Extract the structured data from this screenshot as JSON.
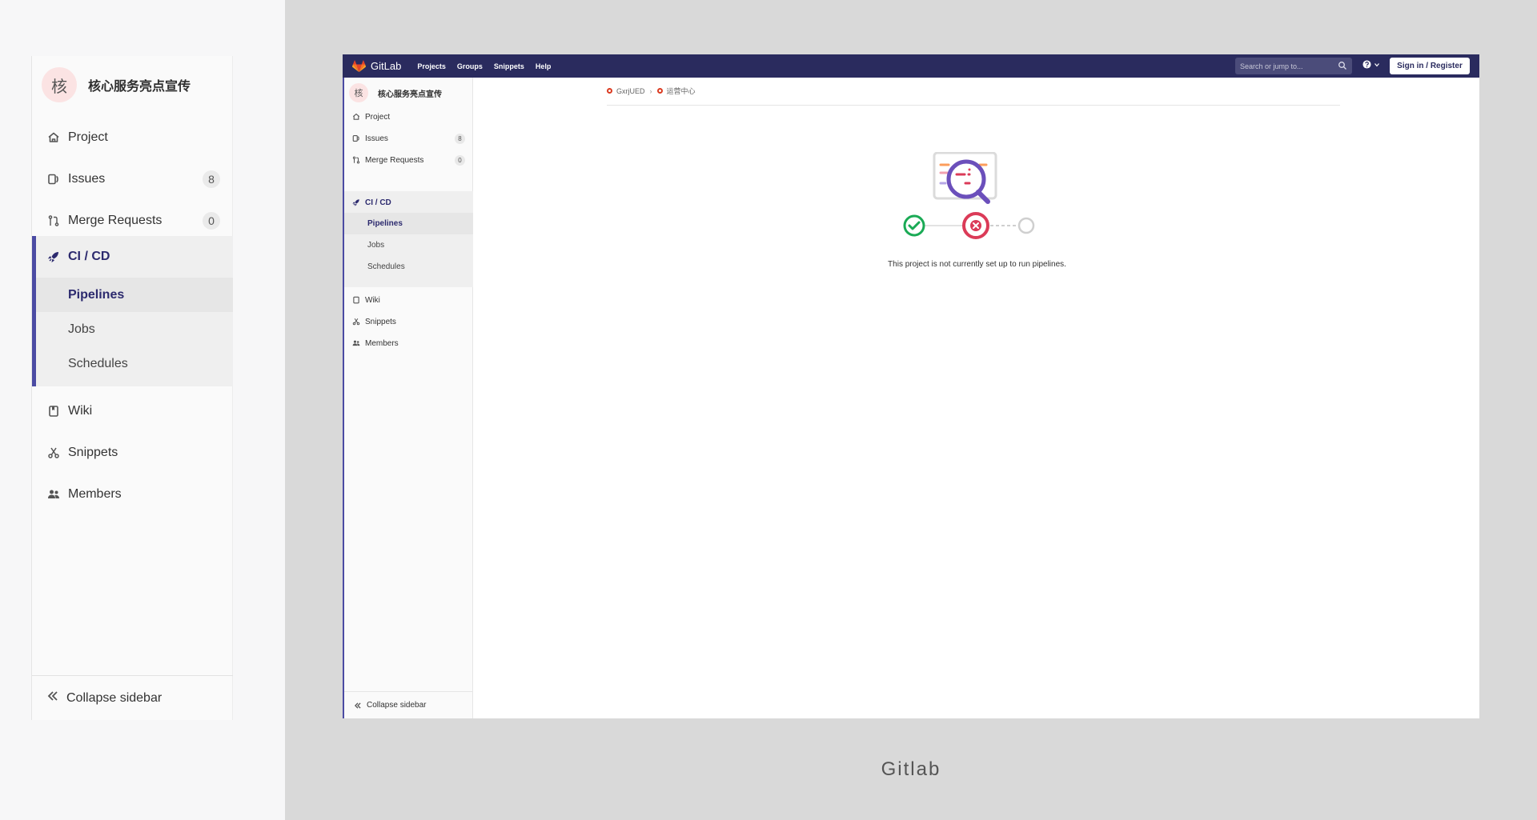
{
  "zoom": {
    "project": {
      "avatar_letter": "核",
      "name": "核心服务亮点宣传"
    },
    "items": [
      {
        "label": "Project",
        "icon": "home-icon"
      },
      {
        "label": "Issues",
        "icon": "issues-icon",
        "badge": "8"
      },
      {
        "label": "Merge Requests",
        "icon": "merge-request-icon",
        "badge": "0"
      }
    ],
    "cicd": {
      "label": "CI / CD",
      "icon": "rocket-icon",
      "subitems": [
        "Pipelines",
        "Jobs",
        "Schedules"
      ]
    },
    "bottom_items": [
      {
        "label": "Wiki",
        "icon": "book-icon"
      },
      {
        "label": "Snippets",
        "icon": "scissors-icon"
      },
      {
        "label": "Members",
        "icon": "users-icon"
      }
    ],
    "collapse_label": "Collapse sidebar"
  },
  "navbar": {
    "brand": "GitLab",
    "links": [
      "Projects",
      "Groups",
      "Snippets",
      "Help"
    ],
    "search_placeholder": "Search or jump to...",
    "help_icon": "question-icon",
    "sign_in": "Sign in / Register"
  },
  "sidebar": {
    "project": {
      "avatar_letter": "核",
      "name": "核心服务亮点宣传"
    },
    "items": [
      {
        "label": "Project"
      },
      {
        "label": "Issues",
        "badge": "8"
      },
      {
        "label": "Merge Requests",
        "badge": "0"
      }
    ],
    "cicd": {
      "label": "CI / CD",
      "subitems": [
        "Pipelines",
        "Jobs",
        "Schedules"
      ]
    },
    "bottom_items": [
      {
        "label": "Wiki"
      },
      {
        "label": "Snippets"
      },
      {
        "label": "Members"
      }
    ],
    "collapse_label": "Collapse sidebar"
  },
  "breadcrumb": [
    "GxrjUED",
    "运营中心"
  ],
  "empty_state": {
    "message": "This project is not currently set up to run pipelines."
  },
  "caption": "Gitlab",
  "colors": {
    "navbar": "#2a2b5e",
    "accent": "#4b4ba3",
    "success": "#1aaa55",
    "failed": "#db3b58",
    "pending": "#cfcfcf"
  }
}
